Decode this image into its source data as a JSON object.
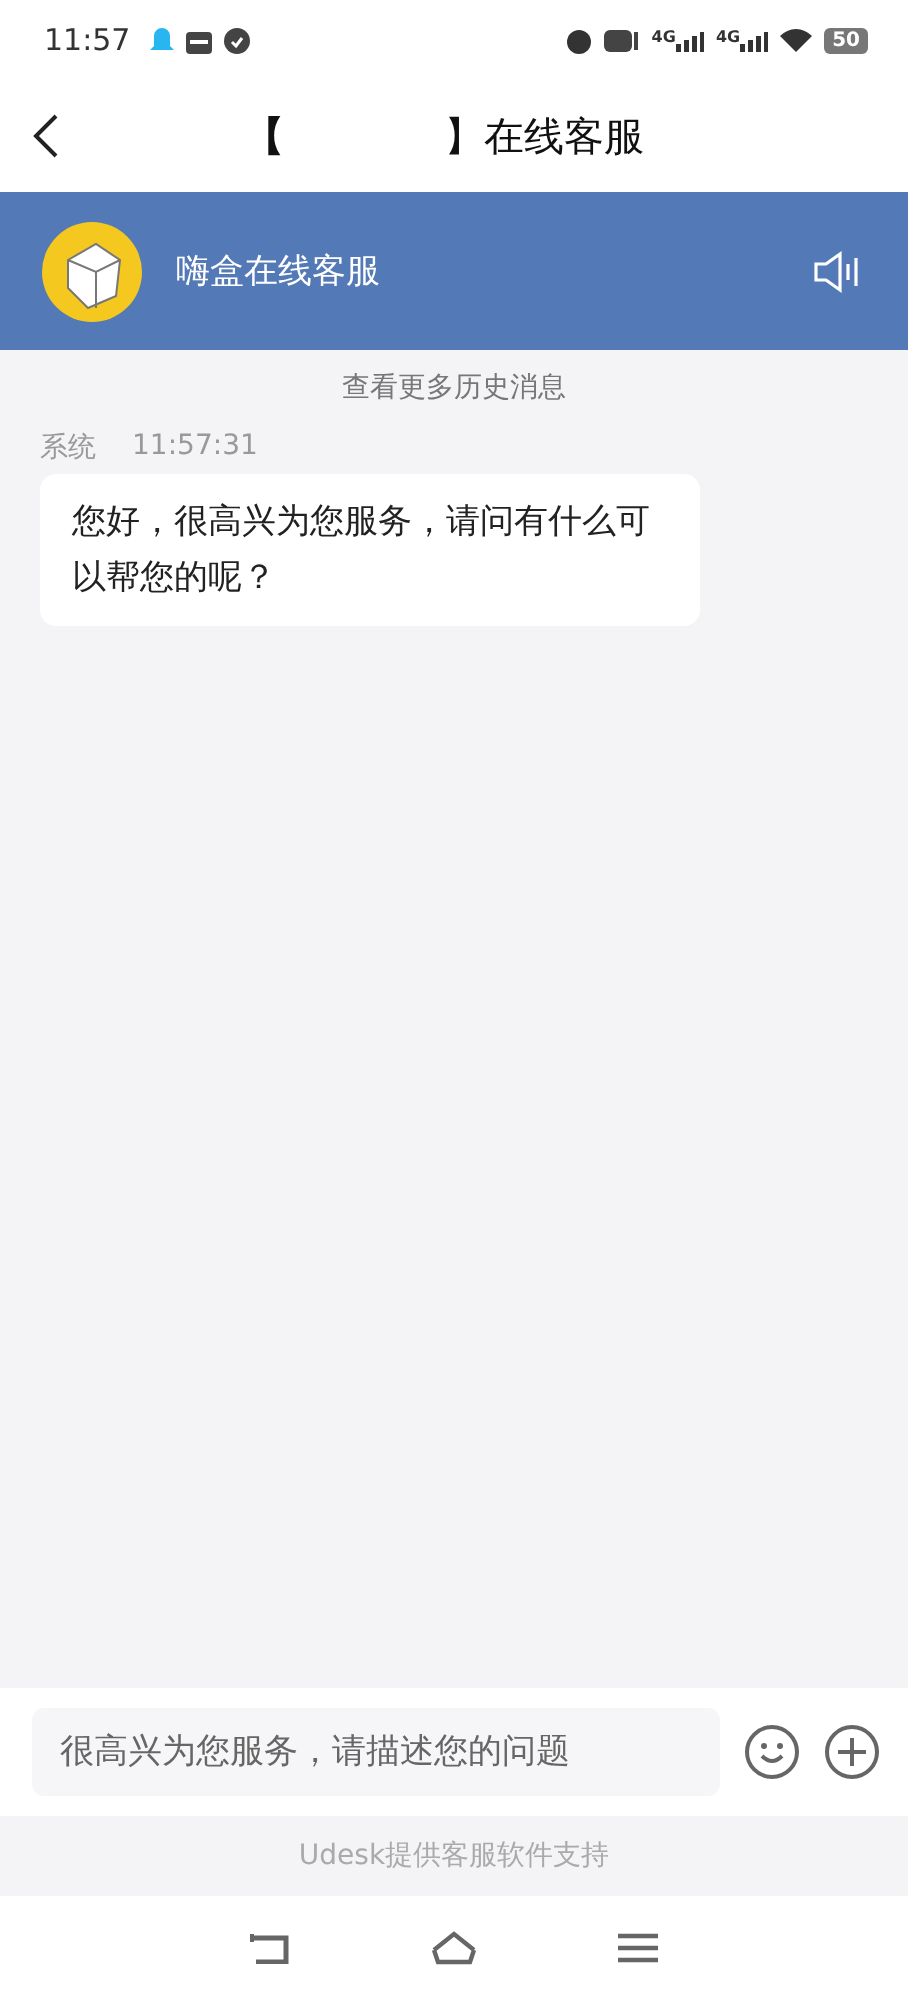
{
  "status_bar": {
    "time": "11:57",
    "networks": [
      "4G",
      "4G"
    ],
    "battery": "50"
  },
  "nav": {
    "title_open": "【",
    "title_rest": "】在线客服"
  },
  "agent_header": {
    "name": "嗨盒在线客服",
    "sound_on": true
  },
  "history_link": "查看更多历史消息",
  "messages": [
    {
      "sender": "系统",
      "time": "11:57:31",
      "text": "您好，很高兴为您服务，请问有什么可以帮您的呢？"
    }
  ],
  "composer": {
    "placeholder": "很高兴为您服务，请描述您的问题"
  },
  "footer": "Udesk提供客服软件支持"
}
